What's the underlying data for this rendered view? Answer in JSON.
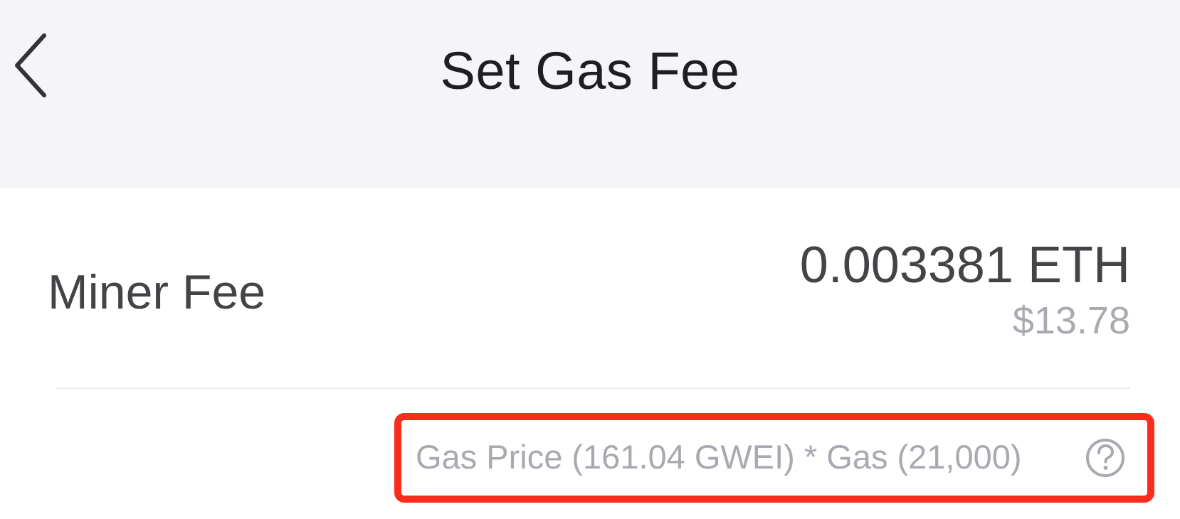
{
  "header": {
    "title": "Set Gas Fee",
    "back_icon": "chevron-left-icon"
  },
  "miner_fee": {
    "label": "Miner Fee",
    "eth_value": "0.003381 ETH",
    "usd_value": "$13.78"
  },
  "gas_formula": {
    "text": "Gas Price (161.04 GWEI) * Gas (21,000)",
    "help_icon": "question-circle-icon",
    "highlight_color": "#fa2d1c"
  },
  "colors": {
    "background": "#f5f5f7",
    "card": "#ffffff",
    "primary_text": "#444448",
    "secondary_text": "#a9a9b1",
    "title_text": "#1f1f22"
  }
}
